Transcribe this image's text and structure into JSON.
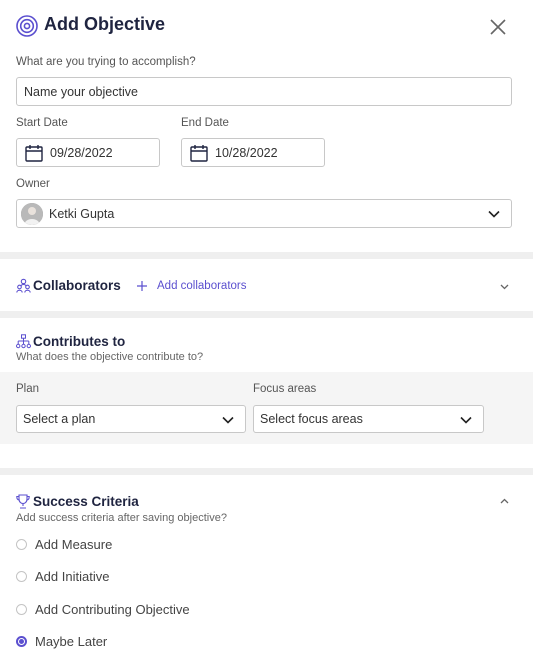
{
  "header": {
    "title": "Add Objective",
    "icons": {
      "title": "target-icon",
      "close": "close-icon"
    }
  },
  "objective": {
    "label": "What are you trying to accomplish?",
    "placeholder": "Name your objective"
  },
  "dates": {
    "start_label": "Start Date",
    "start_value": "09/28/2022",
    "end_label": "End Date",
    "end_value": "10/28/2022"
  },
  "owner": {
    "label": "Owner",
    "value": "Ketki Gupta"
  },
  "collaborators": {
    "title": "Collaborators",
    "add_label": "Add collaborators"
  },
  "contributes": {
    "title": "Contributes to",
    "subtitle": "What does the objective contribute to?",
    "plan_label": "Plan",
    "plan_placeholder": "Select a plan",
    "focus_label": "Focus areas",
    "focus_placeholder": "Select focus areas"
  },
  "success": {
    "title": "Success Criteria",
    "subtitle": "Add success criteria after saving objective?",
    "options": [
      {
        "label": "Add Measure",
        "checked": false
      },
      {
        "label": "Add Initiative",
        "checked": false
      },
      {
        "label": "Add Contributing Objective",
        "checked": false
      },
      {
        "label": "Maybe Later",
        "checked": true
      }
    ]
  },
  "colors": {
    "accent": "#5b4fcf",
    "title": "#1f2440",
    "divider": "#efefef"
  }
}
